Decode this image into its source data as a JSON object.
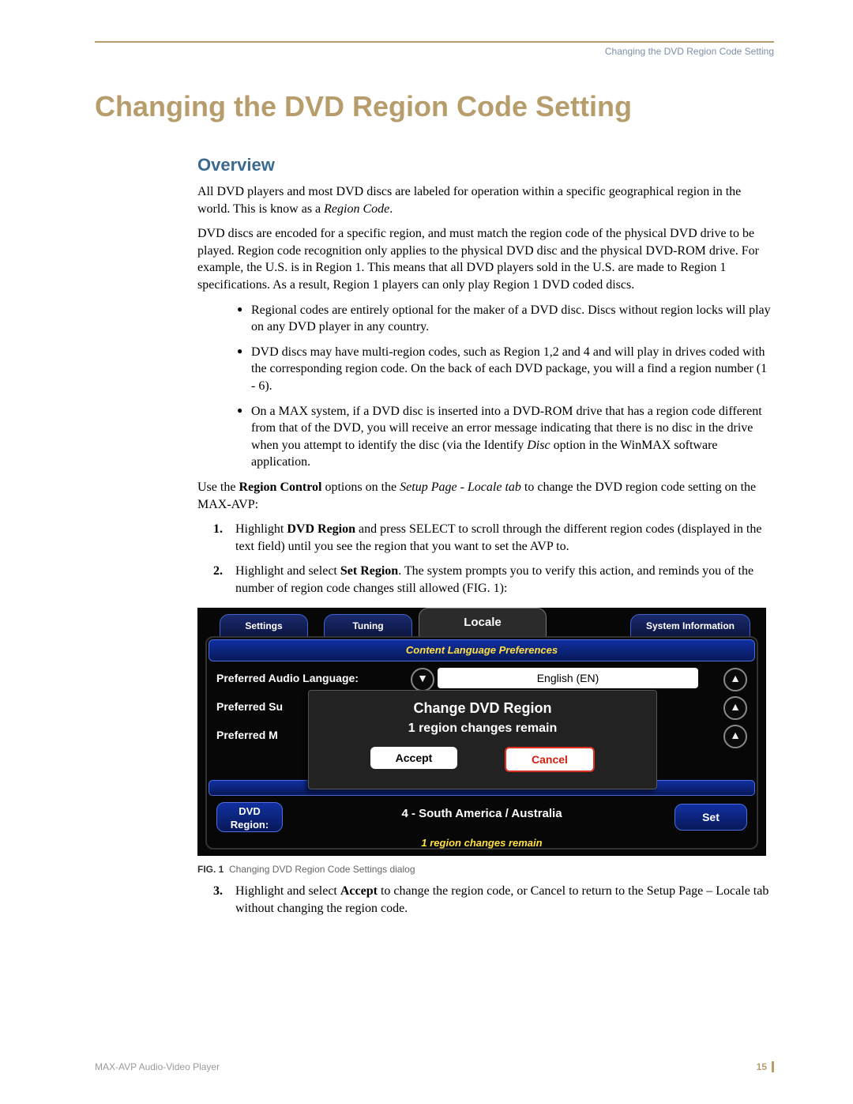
{
  "running_head": "Changing the DVD Region Code Setting",
  "chapter_title": "Changing the DVD Region Code Setting",
  "section_title": "Overview",
  "para1_a": "All DVD players and most DVD discs are labeled for operation within a specific geographical region in the world. This is know as a ",
  "para1_italic": "Region Code",
  "para1_b": ".",
  "para2": "DVD discs are encoded for a specific region, and must match the region code of the physical DVD drive to be played. Region code recognition only applies to the physical DVD disc and the physical DVD-ROM drive. For example, the U.S. is in Region 1. This means that all DVD players sold in the U.S. are made to Region 1 specifications. As a result, Region 1 players can only play Region 1 DVD coded discs.",
  "bullets": {
    "b1": "Regional codes are entirely optional for the maker of a DVD disc. Discs without region locks will play on any DVD player in any country.",
    "b2": "DVD discs may have multi-region codes, such as Region 1,2 and 4 and will play in drives coded with the corresponding region code. On the back of each DVD package, you will a find a region number (1 - 6).",
    "b3_a": "On a MAX system, if a DVD disc is inserted into a DVD-ROM drive that has a region code different from that of the DVD, you will receive an error message indicating that there is no disc in the drive when you attempt to identify the disc (via the Identify ",
    "b3_italic": "Disc",
    "b3_b": " option in the WinMAX software application."
  },
  "para3_a": "Use the ",
  "para3_bold": "Region Control",
  "para3_b": " options on the ",
  "para3_italic": "Setup Page - Locale tab",
  "para3_c": " to change the DVD region code setting on the MAX-AVP:",
  "steps": {
    "s1_a": "Highlight ",
    "s1_bold": "DVD Region",
    "s1_b": " and press SELECT to scroll through the different region codes (displayed in the text field) until you see the region that you want to set the AVP to.",
    "s2_a": "Highlight and select ",
    "s2_bold": "Set Region",
    "s2_b": ". The system prompts you to verify this action, and reminds you of the number of region code changes still allowed (FIG. 1):",
    "s3_a": "Highlight and select ",
    "s3_bold": "Accept",
    "s3_b": " to change the region code, or Cancel to return to the Setup Page – Locale tab without changing the region code."
  },
  "figure": {
    "tabs": {
      "settings": "Settings",
      "tuning": "Tuning",
      "locale": "Locale",
      "sysinfo": "System Information"
    },
    "section_bar": "Content Language Preferences",
    "rows": {
      "r1_label": "Preferred Audio Language:",
      "r1_value": "English (EN)",
      "r2_label": "Preferred Su",
      "r3_label": "Preferred M"
    },
    "dvd": {
      "label_line1": "DVD",
      "label_line2": "Region:",
      "value": "4 - South America / Australia",
      "set": "Set"
    },
    "remain": "1 region changes remain",
    "modal": {
      "title": "Change DVD Region",
      "sub": "1 region changes remain",
      "accept": "Accept",
      "cancel": "Cancel"
    },
    "glyphs": {
      "down": "▼",
      "up": "▲"
    }
  },
  "fig_caption_label": "FIG. 1",
  "fig_caption_text": "Changing DVD Region Code Settings dialog",
  "footer": {
    "doc": "MAX-AVP Audio-Video Player",
    "page": "15"
  }
}
